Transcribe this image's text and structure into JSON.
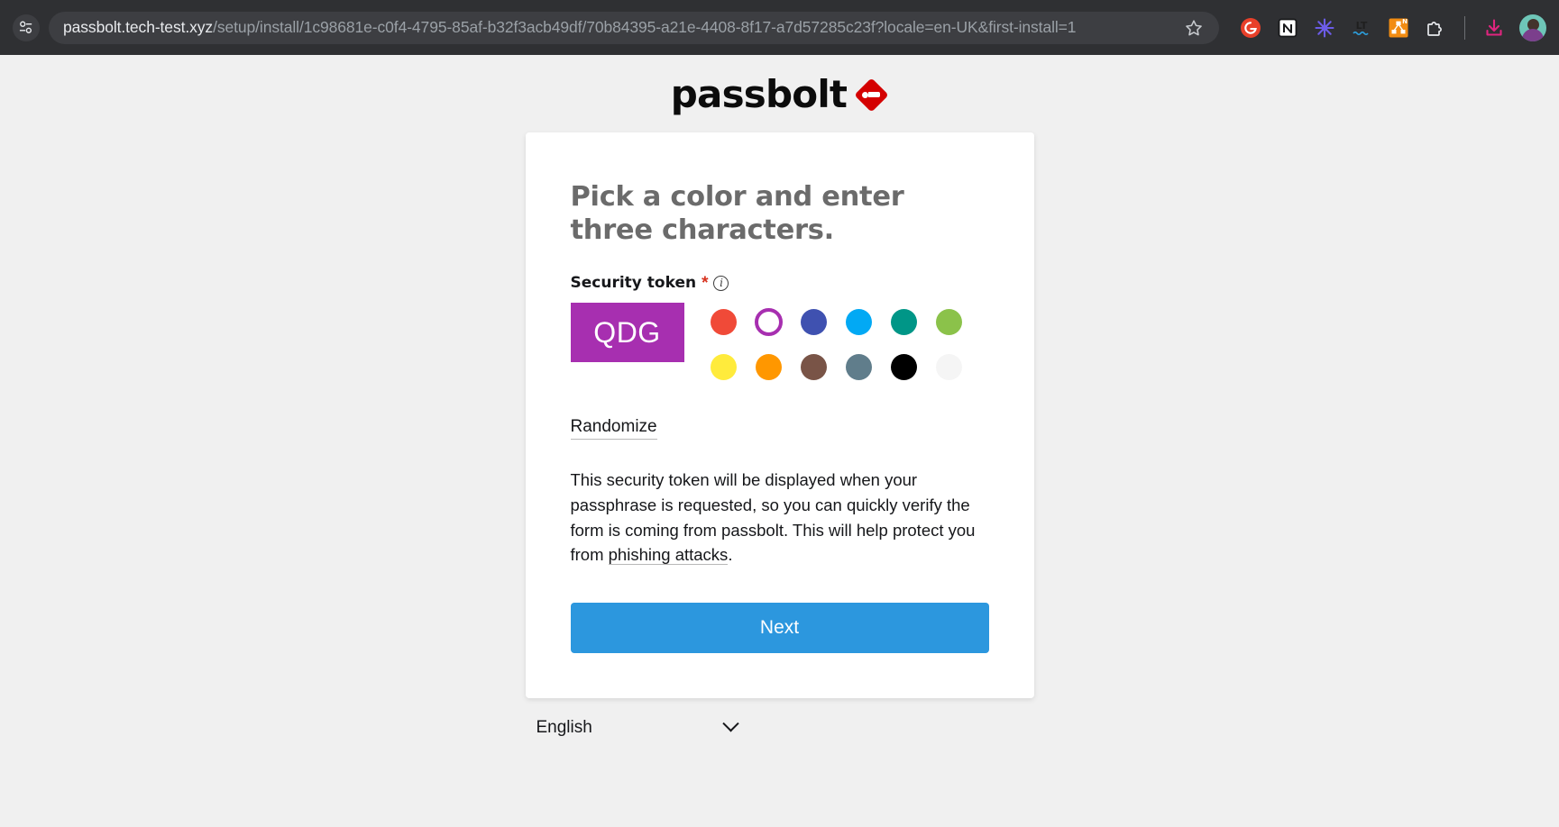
{
  "browser": {
    "site_info_icon": "page-info-icon",
    "url_host": "passbolt.tech-test.xyz",
    "url_path": "/setup/install/1c98681e-c0f4-4795-85af-b32f3acb49df/70b84395-a21e-4408-8f17-a7d57285c23f?locale=en-UK&first-install=1",
    "bookmark_icon": "star-icon",
    "extensions": [
      {
        "name": "grammarly-extension-icon",
        "color": "#e8402a",
        "glyph": "G"
      },
      {
        "name": "notion-extension-icon",
        "color": "#ffffff",
        "glyph": "N"
      },
      {
        "name": "asterisk-extension-icon",
        "color": "#6c5ce7",
        "glyph": "*"
      },
      {
        "name": "languagetool-extension-icon",
        "color": "#2b2b2b",
        "glyph": "LT"
      },
      {
        "name": "mindmap-extension-icon",
        "color": "#f28c12",
        "glyph": "M"
      },
      {
        "name": "puzzle-extensions-icon",
        "color": "#ffffff",
        "glyph": "P"
      }
    ],
    "download_icon": "download-icon",
    "download_color": "#e0257f",
    "profile_avatar": "user-avatar"
  },
  "logo": {
    "text": "passbolt",
    "mark": "passbolt-key-diamond-icon",
    "mark_color": "#d40101"
  },
  "card": {
    "title": "Pick a color and enter three characters.",
    "field": {
      "label": "Security token",
      "required_marker": "*",
      "info_icon": "info-icon",
      "info_glyph": "i"
    },
    "token": {
      "value": "QDG",
      "background_color": "#a72fb0",
      "text_color": "#ffffff"
    },
    "colors": [
      {
        "name": "red",
        "hex": "#f04a38",
        "selected": false
      },
      {
        "name": "purple",
        "hex": "#a72fb0",
        "selected": true
      },
      {
        "name": "indigo",
        "hex": "#3f51b0",
        "selected": false
      },
      {
        "name": "light-blue",
        "hex": "#02a9f4",
        "selected": false
      },
      {
        "name": "teal",
        "hex": "#009687",
        "selected": false
      },
      {
        "name": "green",
        "hex": "#8bc24a",
        "selected": false
      },
      {
        "name": "yellow",
        "hex": "#ffeb3c",
        "selected": false
      },
      {
        "name": "orange",
        "hex": "#ff9700",
        "selected": false
      },
      {
        "name": "brown",
        "hex": "#795447",
        "selected": false
      },
      {
        "name": "blue-grey",
        "hex": "#607d8b",
        "selected": false
      },
      {
        "name": "black",
        "hex": "#000000",
        "selected": false
      },
      {
        "name": "white",
        "hex": "#f5f5f5",
        "selected": false
      }
    ],
    "randomize_label": "Randomize",
    "description_part1": "This security token will be displayed when your passphrase is requested, so you can quickly verify the form is coming from passbolt. This will help protect you from ",
    "description_link": "phishing attacks",
    "description_part2": ".",
    "next_label": "Next",
    "next_color": "#2c97de"
  },
  "footer": {
    "language_value": "English",
    "chevron_icon": "chevron-down-icon"
  }
}
